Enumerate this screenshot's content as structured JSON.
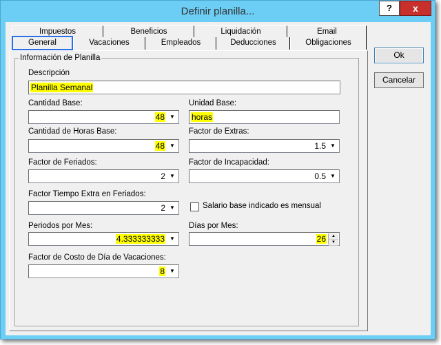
{
  "window": {
    "title": "Definir planilla..."
  },
  "titlebar": {
    "help_label": "?",
    "close_label": "x"
  },
  "tabs": {
    "row1": [
      "Impuestos",
      "Beneficios",
      "Liquidación",
      "Email"
    ],
    "row2": [
      "General",
      "Vacaciones",
      "Empleados",
      "Deducciones",
      "Obligaciones"
    ],
    "active": "General"
  },
  "group": {
    "label": "Información de Planilla"
  },
  "fields": {
    "descripcion": {
      "label": "Descripción",
      "value": "Planilla Semanal"
    },
    "cantidad_base": {
      "label": "Cantidad Base:",
      "value": "48"
    },
    "unidad_base": {
      "label": "Unidad Base:",
      "value": "horas"
    },
    "cantidad_horas_base": {
      "label": "Cantidad de Horas Base:",
      "value": "48"
    },
    "factor_extras": {
      "label": "Factor de Extras:",
      "value": "1.5"
    },
    "factor_feriados": {
      "label": "Factor de Feriados:",
      "value": "2"
    },
    "factor_incapacidad": {
      "label": "Factor de Incapacidad:",
      "value": "0.5"
    },
    "factor_tiempo_extra_feriados": {
      "label": "Factor Tiempo Extra en Feriados:",
      "value": "2"
    },
    "salario_mensual": {
      "label": "Salario base indicado es mensual",
      "checked": false
    },
    "periodos_por_mes": {
      "label": "Periodos por Mes:",
      "value": "4.333333333"
    },
    "dias_por_mes": {
      "label": "Días por Mes:",
      "value": "26"
    },
    "factor_costo_vacaciones": {
      "label": "Factor de Costo de Día de Vacaciones:",
      "value": "8"
    }
  },
  "buttons": {
    "ok": "Ok",
    "cancel": "Cancelar"
  },
  "colors": {
    "titlebar": "#6ccdf5",
    "close": "#c8312b",
    "highlight": "#ffff00",
    "active_tab_border": "#2b6fe8"
  }
}
